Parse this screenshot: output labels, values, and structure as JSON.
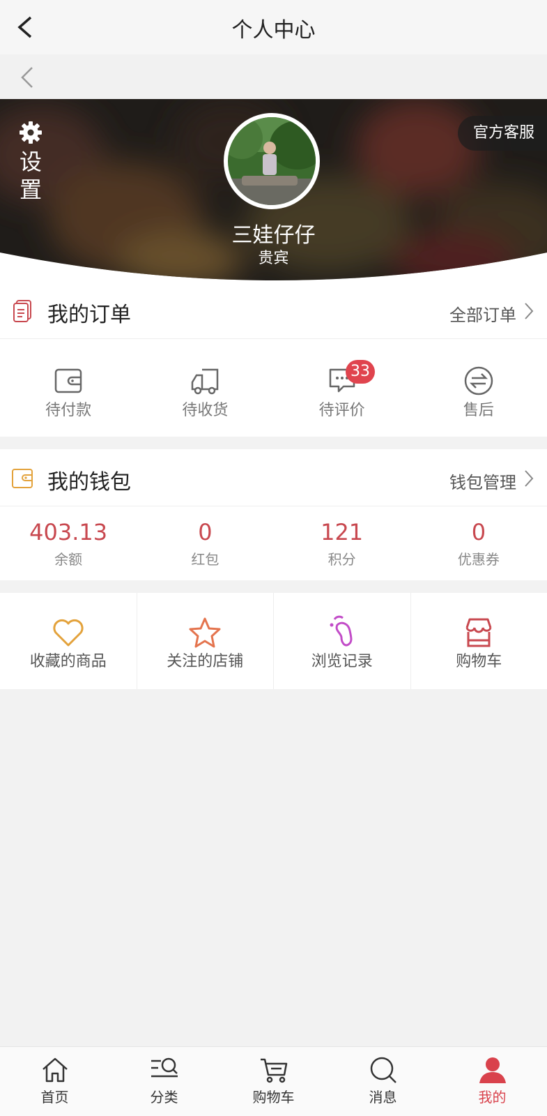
{
  "topbar": {
    "title": "个人中心"
  },
  "profile": {
    "settings_label_1": "设",
    "settings_label_2": "置",
    "service_button": "官方客服",
    "username": "三娃仔仔",
    "level": "贵宾"
  },
  "orders": {
    "title": "我的订单",
    "link": "全部订单",
    "items": [
      {
        "label": "待付款",
        "icon": "wallet-icon"
      },
      {
        "label": "待收货",
        "icon": "truck-icon"
      },
      {
        "label": "待评价",
        "icon": "comment-icon",
        "badge": "33"
      },
      {
        "label": "售后",
        "icon": "exchange-icon"
      }
    ]
  },
  "wallet": {
    "title": "我的钱包",
    "link": "钱包管理",
    "items": [
      {
        "value": "403.13",
        "label": "余额"
      },
      {
        "value": "0",
        "label": "红包"
      },
      {
        "value": "121",
        "label": "积分"
      },
      {
        "value": "0",
        "label": "优惠券"
      }
    ]
  },
  "shortcuts": [
    {
      "label": "收藏的商品",
      "icon": "heart-icon",
      "color": "#e3a23b"
    },
    {
      "label": "关注的店铺",
      "icon": "star-icon",
      "color": "#e4744e"
    },
    {
      "label": "浏览记录",
      "icon": "footprint-icon",
      "color": "#c24cc8"
    },
    {
      "label": "购物车",
      "icon": "shop-icon",
      "color": "#c8484f"
    }
  ],
  "tabbar": [
    {
      "label": "首页",
      "icon": "home-icon"
    },
    {
      "label": "分类",
      "icon": "category-search-icon"
    },
    {
      "label": "购物车",
      "icon": "cart-icon"
    },
    {
      "label": "消息",
      "icon": "search-icon"
    },
    {
      "label": "我的",
      "icon": "user-icon",
      "active": true
    }
  ],
  "colors": {
    "accent": "#d9424c",
    "wallet_value": "#c8484f"
  }
}
